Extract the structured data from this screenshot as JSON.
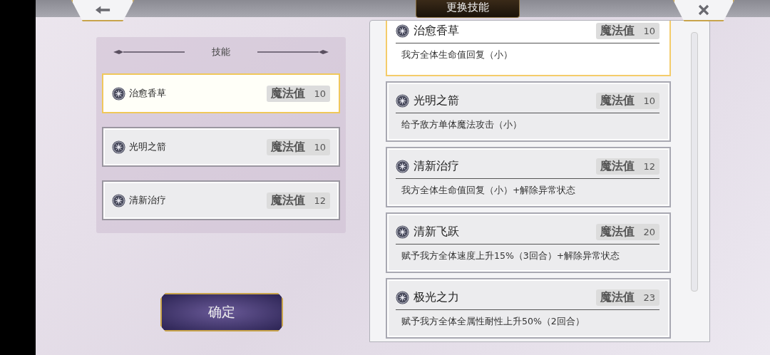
{
  "header": {
    "title": "更换技能"
  },
  "equipped": {
    "title": "技能",
    "slots": [
      {
        "name": "治愈香草",
        "mp_label": "魔法值",
        "cost": "10",
        "selected": true
      },
      {
        "name": "光明之箭",
        "mp_label": "魔法值",
        "cost": "10",
        "selected": false
      },
      {
        "name": "清新治疗",
        "mp_label": "魔法值",
        "cost": "12",
        "selected": false
      }
    ]
  },
  "confirm_button": "确定",
  "skill_list": {
    "items": [
      {
        "name": "治愈香草",
        "mp_label": "魔法值",
        "cost": "10",
        "description": "我方全体生命值回复（小）",
        "selected": true
      },
      {
        "name": "光明之箭",
        "mp_label": "魔法值",
        "cost": "10",
        "description": "给予敌方单体魔法攻击（小）",
        "selected": false
      },
      {
        "name": "清新治疗",
        "mp_label": "魔法值",
        "cost": "12",
        "description": "我方全体生命值回复（小）+解除异常状态",
        "selected": false
      },
      {
        "name": "清新飞跃",
        "mp_label": "魔法值",
        "cost": "20",
        "description": "赋予我方全体速度上升15%（3回合）+解除异常状态",
        "selected": false
      },
      {
        "name": "极光之力",
        "mp_label": "魔法值",
        "cost": "23",
        "description": "赋予我方全体全属性耐性上升50%（2回合）",
        "selected": false
      }
    ]
  }
}
